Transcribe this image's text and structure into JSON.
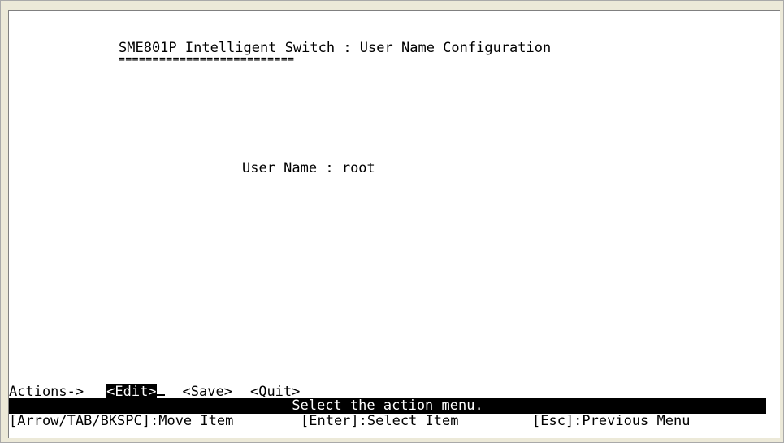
{
  "screen": {
    "title": "SME801P Intelligent Switch : User Name Configuration",
    "title_underline": "==========================",
    "fields": [
      {
        "label": "User Name : ",
        "value": "root"
      }
    ]
  },
  "actions": {
    "label": "Actions->",
    "items": [
      {
        "label": "<Edit>",
        "selected": true
      },
      {
        "label": "<Save>",
        "selected": false
      },
      {
        "label": "<Quit>",
        "selected": false
      }
    ]
  },
  "status": {
    "message": "Select the action menu."
  },
  "help": [
    "[Arrow/TAB/BKSPC]:Move Item",
    "[Enter]:Select Item",
    "[Esc]:Previous Menu"
  ],
  "colors": {
    "background": "#ffffff",
    "foreground": "#000000",
    "highlight_bg": "#000000",
    "highlight_fg": "#ffffff",
    "window_chrome": "#ece9d8"
  }
}
